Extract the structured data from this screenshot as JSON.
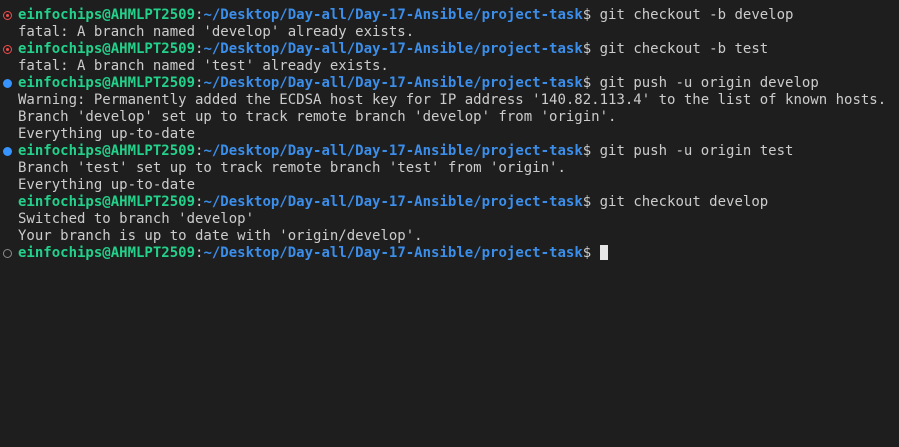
{
  "terminal": {
    "prompt": {
      "user_host": "einfochips@AHMLPT2509",
      "sep": ":",
      "cwd": "~/Desktop/Day-all/Day-17-Ansible/project-task",
      "symbol": "$ "
    },
    "blocks": [
      {
        "status": "error",
        "command": "git checkout -b develop",
        "output": [
          "fatal: A branch named 'develop' already exists."
        ]
      },
      {
        "status": "error",
        "command": "git checkout -b test",
        "output": [
          "fatal: A branch named 'test' already exists."
        ]
      },
      {
        "status": "success",
        "command": "git push -u origin develop",
        "output": [
          "Warning: Permanently added the ECDSA host key for IP address '140.82.113.4' to the list of known hosts.",
          "Branch 'develop' set up to track remote branch 'develop' from 'origin'.",
          "Everything up-to-date"
        ]
      },
      {
        "status": "success",
        "command": "git push -u origin test",
        "output": [
          "Branch 'test' set up to track remote branch 'test' from 'origin'.",
          "Everything up-to-date"
        ]
      },
      {
        "status": "none",
        "command": "git checkout develop",
        "output": [
          "Switched to branch 'develop'",
          "Your branch is up to date with 'origin/develop'."
        ]
      },
      {
        "status": "default",
        "command": "",
        "output": [],
        "active": true
      }
    ]
  },
  "colors": {
    "background": "#1e1e1e",
    "user_host": "#23d18b",
    "path": "#3b8eea",
    "text": "#cccccc",
    "error_decoration": "#f14c4c",
    "success_decoration": "#3794ff"
  },
  "icons": {
    "error": "error-decoration-icon",
    "success": "success-decoration-icon",
    "default": "default-decoration-icon"
  }
}
